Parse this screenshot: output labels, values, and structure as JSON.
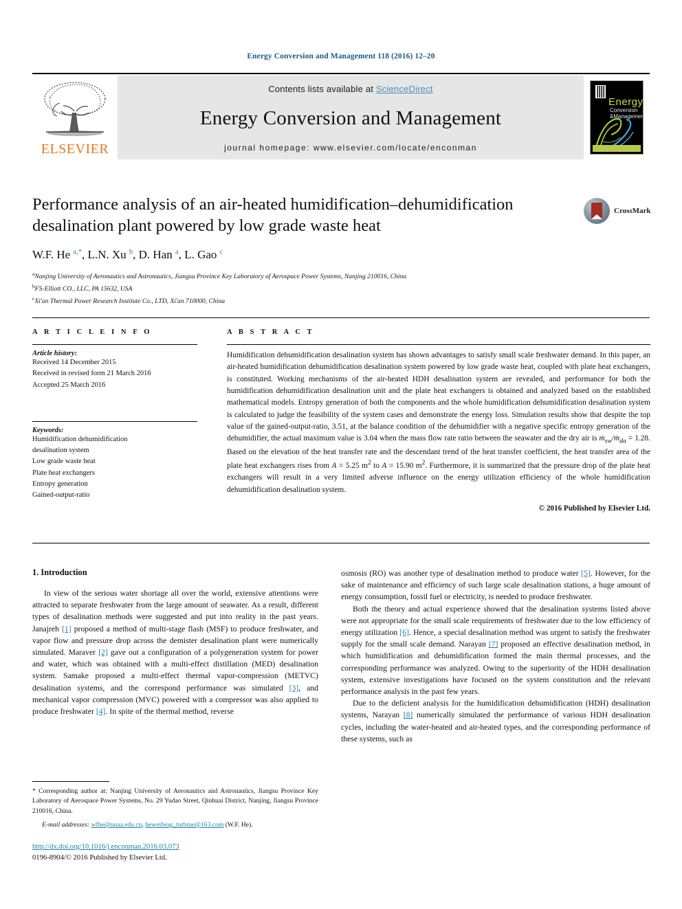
{
  "running_head": "Energy Conversion and Management 118 (2016) 12–20",
  "masthead": {
    "contents_prefix": "Contents lists available at ",
    "sciencedirect": "ScienceDirect",
    "journal_title": "Energy Conversion and Management",
    "homepage": "journal homepage: www.elsevier.com/locate/enconman",
    "publisher_name": "ELSEVIER",
    "publisher_logo_icon": "elsevier-tree-logo",
    "cover": {
      "title": "Energy",
      "sub1": "Conversion",
      "sub2": "&Management"
    },
    "colors": {
      "elsevier_orange": "#e87722",
      "sciencedirect_blue": "#4a8db7",
      "band_grey": "#e6e6e6"
    }
  },
  "article": {
    "title": "Performance analysis of an air-heated humidification–dehumidification desalination plant powered by low grade waste heat",
    "crossmark_label": "CrossMark",
    "authors_html": "W.F. He <sup>a,*</sup>, L.N. Xu <sup>b</sup>, D. Han <sup>a</sup>, L. Gao <sup>c</sup>",
    "affiliations": [
      "Nanjing University of Aeronautics and Astronautics, Jiangsu Province Key Laboratory of Aerospace Power Systems, Nanjing 210016, China",
      "FS-Elliott CO., LLC, PA 15632, USA",
      "Xi'an Thermal Power Research Institute Co., LTD, Xi'an 710000, China"
    ],
    "affiliation_marks": [
      "a",
      "b",
      "c"
    ]
  },
  "article_info": {
    "heading": "A R T I C L E   I N F O",
    "history_label": "Article history:",
    "history": [
      "Received 14 December 2015",
      "Received in revised form 21 March 2016",
      "Accepted 25 March 2016"
    ],
    "keywords_label": "Keywords:",
    "keywords": [
      "Humidification dehumidification",
      "desalination system",
      "Low grade waste heat",
      "Plate heat exchangers",
      "Entropy generation",
      "Gained-output-ratio"
    ]
  },
  "abstract": {
    "heading": "A B S T R A C T",
    "text_part1": "Humidification dehumidification desalination system has shown advantages to satisfy small scale freshwater demand. In this paper, an air-heated humidification dehumidification desalination system powered by low grade waste heat, coupled with plate heat exchangers, is constituted. Working mechanisms of the air-heated HDH desalination system are revealed, and performance for both the humidification dehumidification desalination unit and the plate heat exchangers is obtained and analyzed based on the established mathematical models. Entropy generation of both the components and the whole humidification dehumidification desalination system is calculated to judge the feasibility of the system cases and demonstrate the energy loss. Simulation results show that despite the top value of the gained-output-ratio, 3.51, at the balance condition of the dehumidifier with a negative specific entropy generation of the dehumidifier, the actual maximum value is 3.04 when the mass flow rate ratio between the seawater and the dry air is ",
    "formula_mdot": "ṁ",
    "formula_sub_sw": "sw",
    "formula_slash": "/ṁ",
    "formula_sub_da": "da",
    "formula_eq": " = 1.28",
    "text_part2": ". Based on the elevation of the heat transfer rate and the descendant trend of the heat transfer coefficient, the heat transfer area of the plate heat exchangers rises from ",
    "formula_a1_var": "A",
    "formula_a1_val": " = 5.25 m",
    "formula_a1_sup": "2",
    "text_part3": " to ",
    "formula_a2_var": "A",
    "formula_a2_val": " = 15.90 m",
    "formula_a2_sup": "2",
    "text_part4": ". Furthermore, it is summarized that the pressure drop of the plate heat exchangers will result in a very limited adverse influence on the energy utilization efficiency of the whole humidification dehumidification desalination system.",
    "copyright": "© 2016 Published by Elsevier Ltd."
  },
  "body": {
    "section_title": "1. Introduction",
    "left_p1_a": "In view of the serious water shortage all over the world, extensive attentions were attracted to separate freshwater from the large amount of seawater. As a result, different types of desalination methods were suggested and put into reality in the past years. Janajreh ",
    "ref1": "[1]",
    "left_p1_b": " proposed a method of multi-stage flash (MSF) to produce freshwater, and vapor flow and pressure drop across the demister desalination plant were numerically simulated. Maraver ",
    "ref2": "[2]",
    "left_p1_c": " gave out a configuration of a polygeneration system for power and water, which was obtained with a multi-effect distillation (MED) desalination system. Samake proposed a multi-effect thermal vapor-compression (METVC) desalination systems, and the correspond performance was simulated ",
    "ref3": "[3]",
    "left_p1_d": ", and mechanical vapor compression (MVC) powered with a compressor was also applied to produce freshwater ",
    "ref4": "[4]",
    "left_p1_e": ". In spite of the thermal method, reverse",
    "right_p1_a": "osmosis (RO) was another type of desalination method to produce water ",
    "ref5": "[5]",
    "right_p1_b": ". However, for the sake of maintenance and efficiency of such large scale desalination stations, a huge amount of energy consumption, fossil fuel or electricity, is needed to produce freshwater.",
    "right_p2_a": "Both the theory and actual experience showed that the desalination systems listed above were not appropriate for the small scale requirements of freshwater due to the low efficiency of energy utilization ",
    "ref6": "[6]",
    "right_p2_b": ". Hence, a special desalination method was urgent to satisfy the freshwater supply for the small scale demand. Narayan ",
    "ref7": "[7]",
    "right_p2_c": " proposed an effective desalination method, in which humidification and dehumidification formed the main thermal processes, and the corresponding performance was analyzed. Owing to the superiority of the HDH desalination system, extensive investigations have focused on the system constitution and the relevant performance analysis in the past few years.",
    "right_p3_a": "Due to the deficient analysis for the humidification dehumidification (HDH) desalination systems, Narayan ",
    "ref8": "[8]",
    "right_p3_b": " numerically simulated the performance of various HDH desalination cycles, including the water-heated and air-heated types, and the corresponding performance of these systems, such as"
  },
  "footnote": {
    "marker": "*",
    "corresponding_text": " Corresponding author at: Nanjing University of Aeronautics and Astronautics, Jiangsu Province Key Laboratory of Aerospace Power Systems, No. 29 Yudao Street, Qinhuai District, Nanjing, Jiangsu Province 210016, China.",
    "email_label": "E-mail addresses:",
    "email1": "wfhe@nuaa.edu.cn",
    "email_sep": ", ",
    "email2": "heweifeng_turbine@163.com",
    "email_attrib": " (W.F. He)."
  },
  "publication_footer": {
    "doi": "http://dx.doi.org/10.1016/j.enconman.2016.03.073",
    "issn_line": "0196-8904/© 2016 Published by Elsevier Ltd."
  }
}
